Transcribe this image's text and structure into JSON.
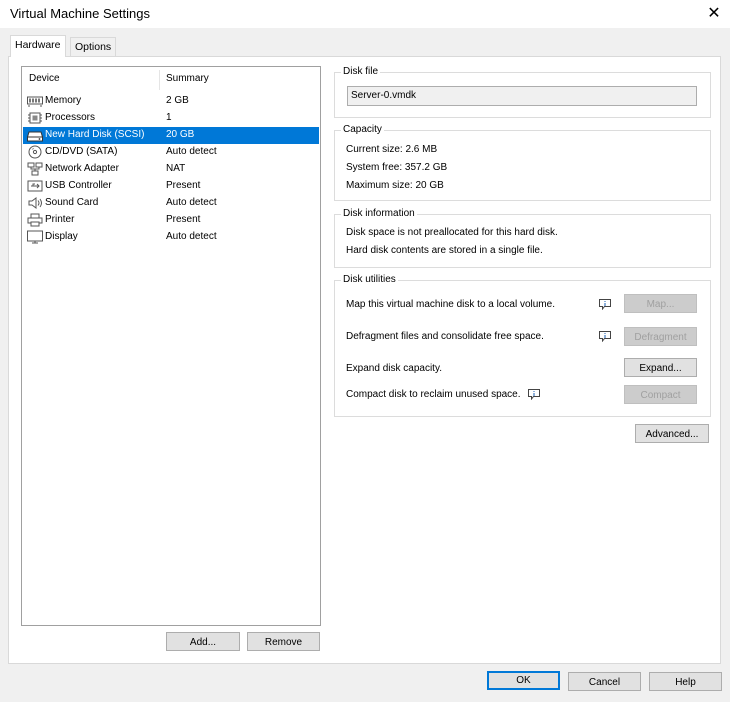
{
  "window": {
    "title": "Virtual Machine Settings",
    "close_glyph": "✕"
  },
  "tabs": [
    {
      "label": "Hardware",
      "active": true
    },
    {
      "label": "Options",
      "active": false
    }
  ],
  "device_list": {
    "columns": {
      "device": "Device",
      "summary": "Summary"
    },
    "rows": [
      {
        "device": "Memory",
        "summary": "2 GB",
        "icon": "memory-icon",
        "selected": false
      },
      {
        "device": "Processors",
        "summary": "1",
        "icon": "processor-icon",
        "selected": false
      },
      {
        "device": "New Hard Disk (SCSI)",
        "summary": "20 GB",
        "icon": "hard-disk-icon",
        "selected": true
      },
      {
        "device": "CD/DVD (SATA)",
        "summary": "Auto detect",
        "icon": "cd-dvd-icon",
        "selected": false
      },
      {
        "device": "Network Adapter",
        "summary": "NAT",
        "icon": "network-adapter-icon",
        "selected": false
      },
      {
        "device": "USB Controller",
        "summary": "Present",
        "icon": "usb-icon",
        "selected": false
      },
      {
        "device": "Sound Card",
        "summary": "Auto detect",
        "icon": "speaker-icon",
        "selected": false
      },
      {
        "device": "Printer",
        "summary": "Present",
        "icon": "printer-icon",
        "selected": false
      },
      {
        "device": "Display",
        "summary": "Auto detect",
        "icon": "display-icon",
        "selected": false
      }
    ],
    "add_label": "Add...",
    "remove_label": "Remove"
  },
  "disk_file": {
    "title": "Disk file",
    "value": "Server-0.vmdk"
  },
  "capacity": {
    "title": "Capacity",
    "current": "Current size: 2.6 MB",
    "free": "System free: 357.2 GB",
    "max": "Maximum size: 20 GB"
  },
  "disk_info": {
    "title": "Disk information",
    "line1": "Disk space is not preallocated for this hard disk.",
    "line2": "Hard disk contents are stored in a single file."
  },
  "utilities": {
    "title": "Disk utilities",
    "map_text": "Map this virtual machine disk to a local volume.",
    "map_button": "Map...",
    "defrag_text": "Defragment files and consolidate free space.",
    "defrag_button": "Defragment",
    "expand_text": "Expand disk capacity.",
    "expand_button": "Expand...",
    "compact_text": "Compact disk to reclaim unused space.",
    "compact_button": "Compact"
  },
  "advanced_button": "Advanced...",
  "footer": {
    "ok": "OK",
    "cancel": "Cancel",
    "help": "Help"
  },
  "colors": {
    "selection": "#0078d7",
    "window_bg": "#f0f0f0",
    "panel_bg": "#ffffff"
  }
}
